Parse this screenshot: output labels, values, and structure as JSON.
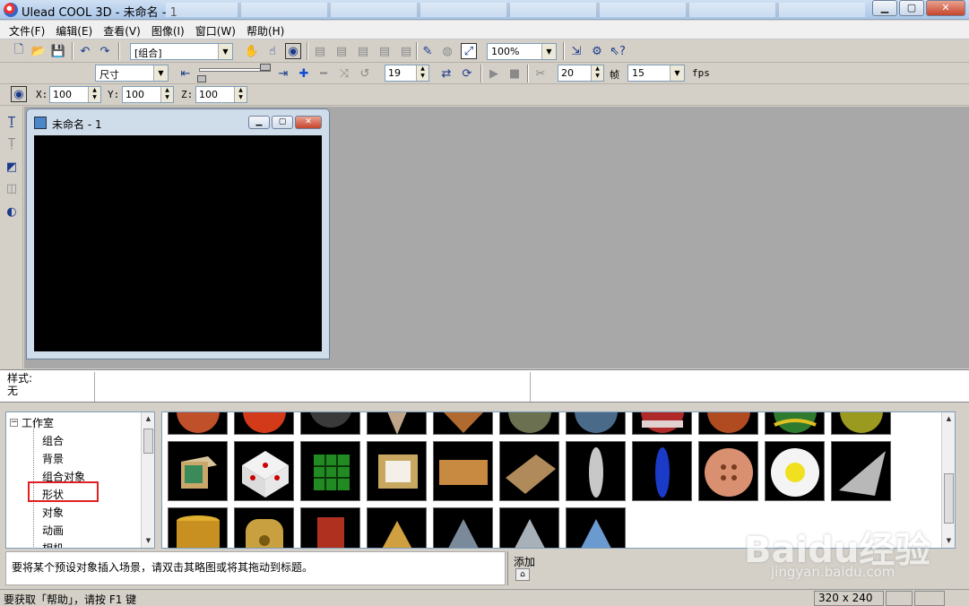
{
  "window": {
    "title": "Ulead COOL 3D - 未命名 - 1"
  },
  "menu": [
    "文件(F)",
    "编辑(E)",
    "查看(V)",
    "图像(I)",
    "窗口(W)",
    "帮助(H)"
  ],
  "toolbar1": {
    "object_select": "[组合]",
    "zoom": "100%"
  },
  "toolbar2": {
    "attribute": "尺寸",
    "frame_value": "19",
    "total_frames": "20",
    "frame_label": "帧",
    "fps_value": "15",
    "fps_label": "fps"
  },
  "toolbar3": {
    "x_label": "X:",
    "x_value": "100",
    "y_label": "Y:",
    "y_value": "100",
    "z_label": "Z:",
    "z_value": "100"
  },
  "document": {
    "title": "未命名 - 1"
  },
  "stylebar": {
    "label": "样式:",
    "value": "无"
  },
  "tree": {
    "root": "工作室",
    "items": [
      "组合",
      "背景",
      "组合对象",
      "形状",
      "对象",
      "动画",
      "相机"
    ],
    "selected": "形状"
  },
  "hint": {
    "text": "要将某个预设对象插入场景，请双击其略图或将其拖动到标题。"
  },
  "add_panel": {
    "label": "添加"
  },
  "status": {
    "help": "要获取「帮助」，请按 F1 键",
    "size": "320 x 240"
  },
  "watermark": {
    "brand": "Baidu经验",
    "url": "jingyan.baidu.com"
  },
  "colors": {
    "highlight": "#e02020",
    "canvas": "#000000",
    "workspace": "#a8a8a8"
  }
}
